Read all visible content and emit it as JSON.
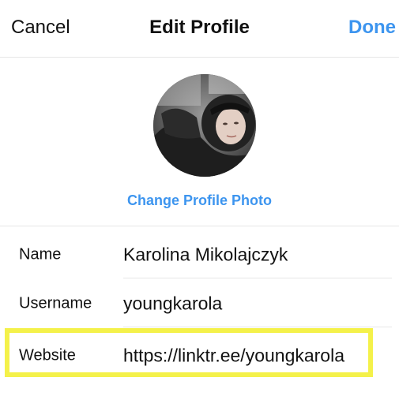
{
  "navbar": {
    "cancel_label": "Cancel",
    "title": "Edit Profile",
    "done_label": "Done"
  },
  "profile": {
    "change_photo_label": "Change Profile Photo"
  },
  "form": {
    "name": {
      "label": "Name",
      "value": "Karolina Mikolajczyk"
    },
    "username": {
      "label": "Username",
      "value": "youngkarola"
    },
    "website": {
      "label": "Website",
      "value": "https://linktr.ee/youngkarola"
    }
  },
  "colors": {
    "accent": "#3d95ef",
    "highlight": "#f4f14a",
    "divider": "#e6e6e6"
  },
  "icons": {
    "avatar": "profile-photo"
  }
}
